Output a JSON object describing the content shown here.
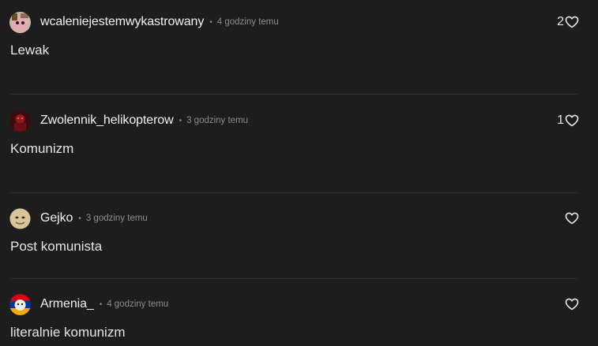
{
  "comments": [
    {
      "username": "wcaleniejestemwykastrowany",
      "separator": "•",
      "time": "4 godziny temu",
      "text": "Lewak",
      "likes": "2",
      "avatar_icon": "avatar-pink-character"
    },
    {
      "username": "Zwolennik_helikopterow",
      "separator": "•",
      "time": "3 godziny temu",
      "text": "Komunizm",
      "likes": "1",
      "avatar_icon": "avatar-red-dark-figure"
    },
    {
      "username": "Gejko",
      "separator": "•",
      "time": "3 godziny temu",
      "text": "Post komunista",
      "likes": "",
      "avatar_icon": "avatar-bald-face"
    },
    {
      "username": "Armenia_",
      "separator": "•",
      "time": "4 godziny temu",
      "text": "literalnie komunizm",
      "likes": "",
      "avatar_icon": "avatar-flag-character"
    }
  ],
  "colors": {
    "background": "#1d1d1d",
    "text": "#e6e6e6",
    "muted": "#8c8c8c",
    "divider": "#303030"
  }
}
